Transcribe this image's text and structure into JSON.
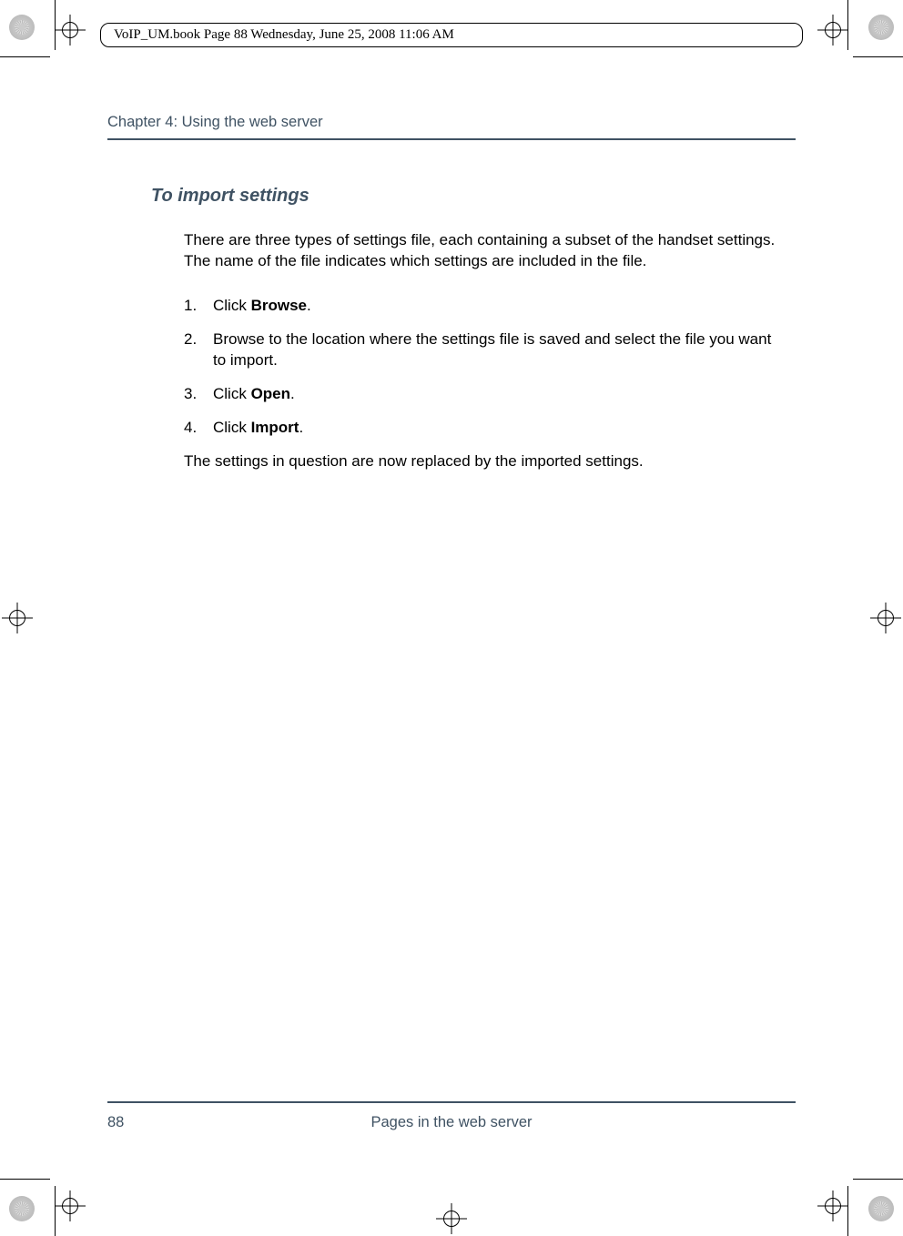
{
  "meta": "VoIP_UM.book  Page 88  Wednesday, June 25, 2008  11:06 AM",
  "chapter": "Chapter 4:  Using the web server",
  "section_title": "To import settings",
  "intro": "There are three types of settings file, each containing a subset of the handset settings. The name of the file indicates which settings are included in the file.",
  "steps": [
    {
      "n": "1.",
      "pre": "Click ",
      "bold": "Browse",
      "post": "."
    },
    {
      "n": "2.",
      "pre": "Browse to the location where the settings file is saved and select the file you want to import.",
      "bold": "",
      "post": ""
    },
    {
      "n": "3.",
      "pre": "Click ",
      "bold": "Open",
      "post": "."
    },
    {
      "n": "4.",
      "pre": "Click ",
      "bold": "Import",
      "post": "."
    }
  ],
  "outro": "The settings in question are now replaced by the imported settings.",
  "footer_page": "88",
  "footer_title": "Pages in the web server"
}
